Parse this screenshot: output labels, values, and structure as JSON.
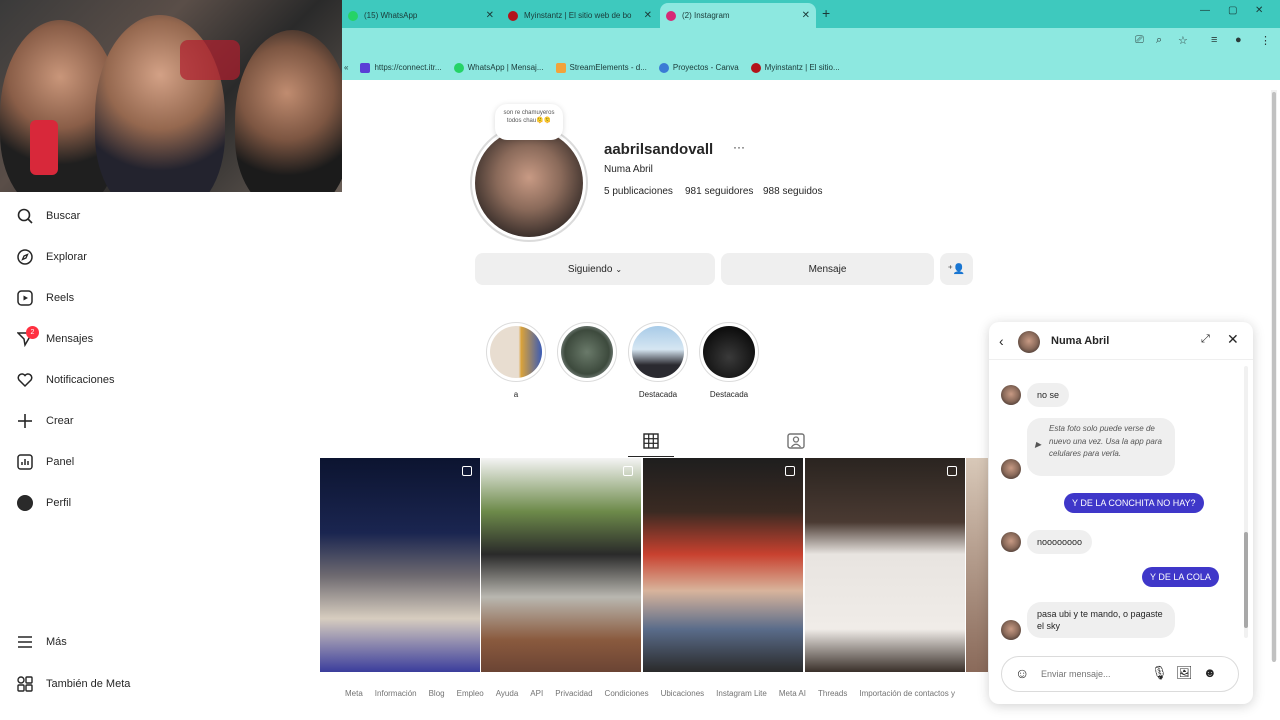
{
  "browser": {
    "tabs": [
      {
        "label": "(15) WhatsApp",
        "icon": "whatsapp-icon",
        "color": "#25d366"
      },
      {
        "label": "Myinstantz | El sitio web de bo",
        "icon": "myinstants-icon",
        "color": "#b3131b"
      },
      {
        "label": "(2) Instagram",
        "icon": "instagram-icon",
        "color": "#d62976"
      }
    ],
    "bookmarks": [
      {
        "label": "https://connect.itr...",
        "color": "#5a3fd6"
      },
      {
        "label": "WhatsApp | Mensaj...",
        "color": "#25d366"
      },
      {
        "label": "StreamElements - d...",
        "color": "#f2a33a"
      },
      {
        "label": "Proyectos - Canva",
        "color": "#3a7bd5"
      },
      {
        "label": "Myinstantz | El sitio...",
        "color": "#b3131b"
      }
    ]
  },
  "sidebar": {
    "items": [
      {
        "label": "Buscar",
        "icon": "search-icon"
      },
      {
        "label": "Explorar",
        "icon": "compass-icon"
      },
      {
        "label": "Reels",
        "icon": "reels-icon"
      },
      {
        "label": "Mensajes",
        "icon": "messenger-icon",
        "badge": "2"
      },
      {
        "label": "Notificaciones",
        "icon": "heart-icon"
      },
      {
        "label": "Crear",
        "icon": "plus-icon"
      },
      {
        "label": "Panel",
        "icon": "dashboard-icon"
      },
      {
        "label": "Perfil",
        "icon": "profile-avatar-icon"
      },
      {
        "label": "Más",
        "icon": "menu-icon"
      },
      {
        "label": "También de Meta",
        "icon": "meta-grid-icon"
      }
    ]
  },
  "profile": {
    "note": "son re chamuyeros todos chau🫠🫠",
    "username": "aabrilsandovall",
    "fullname": "Numa Abril",
    "posts": "5 publicaciones",
    "followers": "981 seguidores",
    "following": "988 seguidos",
    "follow_button": "Siguiendo",
    "message_button": "Mensaje",
    "highlights": [
      {
        "label": "a"
      },
      {
        "label": ""
      },
      {
        "label": "Destacada"
      },
      {
        "label": "Destacada"
      }
    ]
  },
  "footer": [
    "Meta",
    "Información",
    "Blog",
    "Empleo",
    "Ayuda",
    "API",
    "Privacidad",
    "Condiciones",
    "Ubicaciones",
    "Instagram Lite",
    "Meta AI",
    "Threads",
    "Importación de contactos y"
  ],
  "chat": {
    "name": "Numa Abril",
    "messages": [
      {
        "from": "them",
        "text": "no se"
      },
      {
        "from": "them",
        "text": "Esta foto solo puede verse de nuevo una vez. Usa la app para celulares para verla."
      },
      {
        "from": "me",
        "text": "Y DE LA CONCHITA NO HAY?"
      },
      {
        "from": "them",
        "text": "noooooooo"
      },
      {
        "from": "me",
        "text": "Y DE LA COLA"
      },
      {
        "from": "them",
        "text": "pasa ubi y te mando, o pagaste el sky"
      }
    ],
    "input_placeholder": "Enviar mensaje..."
  }
}
